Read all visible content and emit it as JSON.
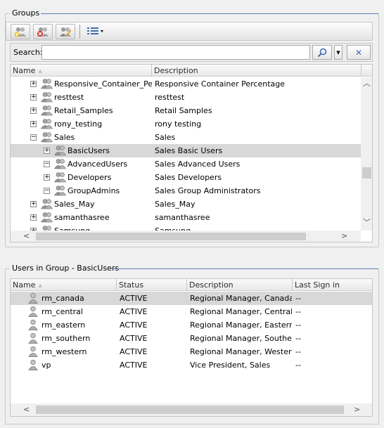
{
  "groups_panel": {
    "title": "Groups",
    "toolbar": {
      "add_group": "add-group-icon",
      "delete_group": "delete-group-icon",
      "edit_group": "edit-group-icon",
      "view_menu": "list-view-icon"
    },
    "search": {
      "label": "Search:",
      "value": "",
      "placeholder": "",
      "clear_symbol": "✕"
    },
    "columns": [
      "Name",
      "Description"
    ],
    "rows": [
      {
        "name": "Responsive_Container_Perce",
        "description": "Responsive Container Percentage",
        "level": 0,
        "expander": "+"
      },
      {
        "name": "resttest",
        "description": "resttest",
        "level": 0,
        "expander": "+"
      },
      {
        "name": "Retail_Samples",
        "description": "Retail Samples",
        "level": 0,
        "expander": "+"
      },
      {
        "name": "rony_testing",
        "description": "rony testing",
        "level": 0,
        "expander": "+"
      },
      {
        "name": "Sales",
        "description": "Sales",
        "level": 0,
        "expander": "−"
      },
      {
        "name": "BasicUsers",
        "description": "Sales Basic Users",
        "level": 1,
        "expander": "+",
        "selected": true
      },
      {
        "name": "AdvancedUsers",
        "description": "Sales Advanced Users",
        "level": 1,
        "expander": "−"
      },
      {
        "name": "Developers",
        "description": "Sales Developers",
        "level": 1,
        "expander": "+"
      },
      {
        "name": "GroupAdmins",
        "description": "Sales Group Administrators",
        "level": 1,
        "expander": "−"
      },
      {
        "name": "Sales_May",
        "description": "Sales_May",
        "level": 0,
        "expander": "+"
      },
      {
        "name": "samanthasree",
        "description": "samanthasree",
        "level": 0,
        "expander": "+"
      },
      {
        "name": "Samsung",
        "description": "Samsung",
        "level": 0,
        "expander": "+"
      }
    ]
  },
  "users_panel": {
    "title": "Users in Group - BasicUsers",
    "columns": [
      "Name",
      "Status",
      "Description",
      "Last Sign in"
    ],
    "rows": [
      {
        "name": "rm_canada",
        "status": "ACTIVE",
        "description": "Regional Manager, Canada",
        "last_sign_in": "--",
        "selected": true
      },
      {
        "name": "rm_central",
        "status": "ACTIVE",
        "description": "Regional Manager, Central",
        "last_sign_in": "--"
      },
      {
        "name": "rm_eastern",
        "status": "ACTIVE",
        "description": "Regional Manager, Eastern",
        "last_sign_in": "--"
      },
      {
        "name": "rm_southern",
        "status": "ACTIVE",
        "description": "Regional Manager, Southern",
        "last_sign_in": "--"
      },
      {
        "name": "rm_western",
        "status": "ACTIVE",
        "description": "Regional Manager, Western",
        "last_sign_in": "--"
      },
      {
        "name": "vp",
        "status": "ACTIVE",
        "description": "Vice President, Sales",
        "last_sign_in": "--"
      }
    ]
  },
  "colors": {
    "selected_row": "#d8d8d8",
    "legend_line": "#5b7fb5"
  }
}
